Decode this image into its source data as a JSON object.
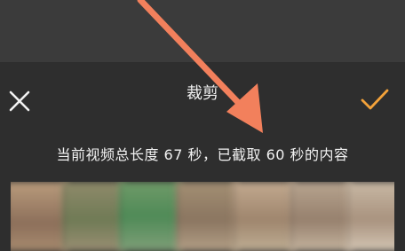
{
  "header": {
    "title": "裁剪"
  },
  "info": {
    "text": "当前视频总长度 67 秒，已截取 60 秒的内容"
  },
  "colors": {
    "accent": "#f3a23a",
    "arrow": "#f2805c",
    "text": "#f2f2f2",
    "background": "#2e2e2e"
  }
}
